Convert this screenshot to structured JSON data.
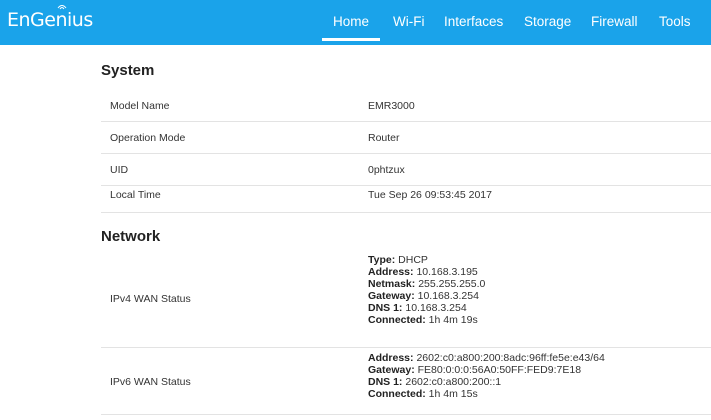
{
  "header": {
    "brand": "EnGenius",
    "brand_icon": "wifi-signal-icon",
    "accent_color": "#1aa3ea",
    "tabs": [
      {
        "label": "Home",
        "active": true
      },
      {
        "label": "Wi-Fi"
      },
      {
        "label": "Interfaces"
      },
      {
        "label": "Storage"
      },
      {
        "label": "Firewall"
      },
      {
        "label": "Tools"
      }
    ]
  },
  "system": {
    "title": "System",
    "rows": [
      {
        "label": "Model Name",
        "value": "EMR3000"
      },
      {
        "label": "Operation Mode",
        "value": "Router"
      },
      {
        "label": "UID",
        "value": "0phtzux"
      },
      {
        "label": "Local Time",
        "value": "Tue Sep 26 09:53:45 2017"
      }
    ]
  },
  "network": {
    "title": "Network",
    "ipv4": {
      "label": "IPv4 WAN Status",
      "type_key": "Type:",
      "type_val": "DHCP",
      "address_key": "Address:",
      "address_val": "10.168.3.195",
      "netmask_key": "Netmask:",
      "netmask_val": "255.255.255.0",
      "gateway_key": "Gateway:",
      "gateway_val": "10.168.3.254",
      "dns_key": "DNS 1:",
      "dns_val": "10.168.3.254",
      "connected_key": "Connected:",
      "connected_val": "1h 4m 19s"
    },
    "ipv6": {
      "label": "IPv6 WAN Status",
      "address_key": "Address:",
      "address_val": "2602:c0:a800:200:8adc:96ff:fe5e:e43/64",
      "gateway_key": "Gateway:",
      "gateway_val": "FE80:0:0:0:56A0:50FF:FED9:7E18",
      "dns_key": "DNS 1:",
      "dns_val": "2602:c0:a800:200::1",
      "connected_key": "Connected:",
      "connected_val": "1h 4m 15s"
    }
  }
}
